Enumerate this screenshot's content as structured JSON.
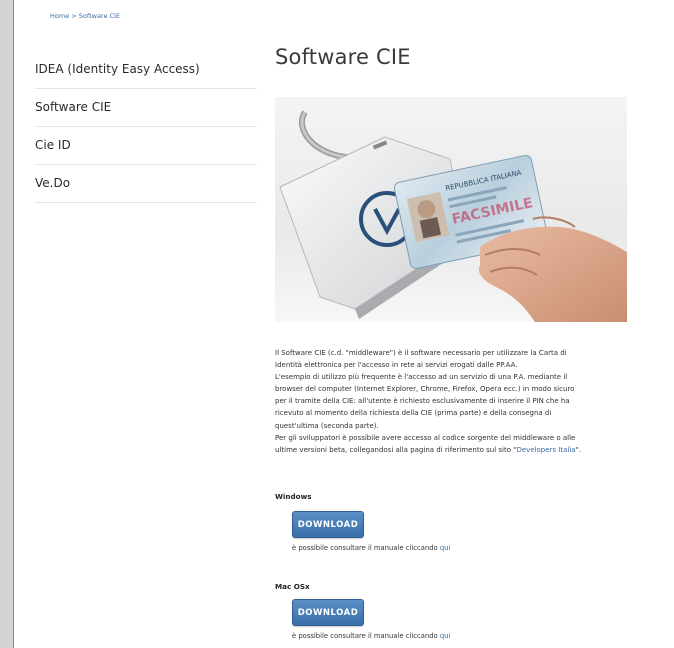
{
  "breadcrumb": {
    "home": "Home",
    "separator": " > ",
    "current": "Software CIE"
  },
  "sidebar": {
    "items": [
      {
        "label": "IDEA (Identity Easy Access)"
      },
      {
        "label": "Software CIE"
      },
      {
        "label": "Cie ID"
      },
      {
        "label": "Ve.Do"
      }
    ]
  },
  "main": {
    "title": "Software CIE",
    "hero_alt_card_text": "REPUBBLICA ITALIANA",
    "hero_card_stamp": "FACSIMILE",
    "paragraph": {
      "line1": "Il Software CIE (c.d. \"middleware\") è il software necessario per utilizzare la Carta di",
      "line2": "Identità elettronica per l'accesso in rete ai servizi erogati dalle PP.AA.",
      "line3": "L'esempio di utilizzo più frequente è l'accesso ad un servizio di una P.A. mediante il",
      "line4": "browser del computer (Internet Explorer, Chrome, Firefox, Opera ecc.) in modo sicuro",
      "line5": "per il tramite della CIE: all'utente è richiesto esclusivamente di inserire il PIN che ha",
      "line6": "ricevuto al momento della richiesta della CIE (prima parte) e della consegna di",
      "line7": "quest'ultima (seconda parte).",
      "line8": "Per gli sviluppatori è possibile avere accesso al codice sorgente del middleware o alle",
      "line9_start": "ultime versioni beta, collegandosi alla pagina di riferimento sul sito \"",
      "link": "Developers Italia",
      "line9_end": "\"."
    },
    "downloads": [
      {
        "os": "Windows",
        "button": "DOWNLOAD",
        "manual_text": "è possibile consultare il manuale cliccando ",
        "manual_link": "qui"
      },
      {
        "os": "Mac OSx",
        "button": "DOWNLOAD",
        "manual_text": "è possibile consultare il manuale cliccando ",
        "manual_link": "qui"
      }
    ]
  },
  "colors": {
    "link": "#3b6aa5",
    "button": "#3a6fa8",
    "page_bg": "#d4d4d6"
  }
}
